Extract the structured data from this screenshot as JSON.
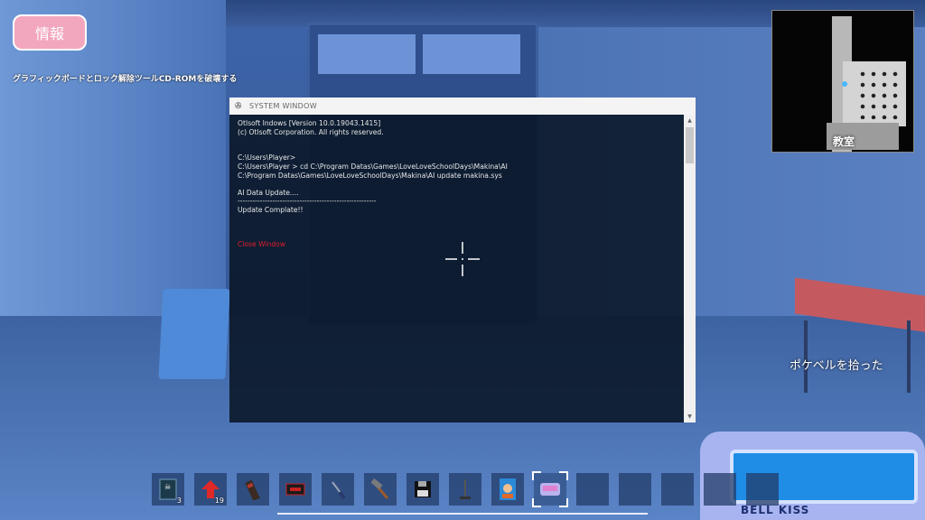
{
  "hud": {
    "info_button_label": "情報",
    "objective_text": "グラフィックボードとロック解除ツールCD-ROMを破壊する",
    "pickup_message": "ポケベルを拾った"
  },
  "minimap": {
    "location_label": "教室"
  },
  "system_window": {
    "title": "SYSTEM WINDOW",
    "lines": [
      "Otlsoft Indows [Version 10.0.19043.1415]",
      "(c) Otlsoft Corporation. All rights reserved.",
      "",
      "",
      "C:\\Users\\Player>",
      "C:\\Users\\Player > cd C:\\Program Datas\\Games\\LoveLoveSchoolDays\\Makina\\AI",
      "C:\\Program Datas\\Games\\LoveLoveSchoolDays\\Makina\\AI update makina.sys",
      "",
      "AI Data Update....",
      "--------------------------------------------------------",
      "Update Complate!!",
      "",
      "",
      ""
    ],
    "close_link": "Close Window"
  },
  "hotbar": {
    "slots": [
      {
        "icon": "cd-case-icon",
        "count": "3"
      },
      {
        "icon": "red-arrow-icon",
        "count": "19"
      },
      {
        "icon": "battery-pack-icon",
        "count": ""
      },
      {
        "icon": "red-device-icon",
        "count": ""
      },
      {
        "icon": "screwdriver-icon",
        "count": ""
      },
      {
        "icon": "hammer-icon",
        "count": ""
      },
      {
        "icon": "floppy-disk-icon",
        "count": ""
      },
      {
        "icon": "stand-icon",
        "count": ""
      },
      {
        "icon": "game-box-icon",
        "count": ""
      },
      {
        "icon": "pager-icon",
        "count": "",
        "selected": true
      },
      {
        "icon": "",
        "count": ""
      },
      {
        "icon": "",
        "count": ""
      },
      {
        "icon": "",
        "count": ""
      },
      {
        "icon": "",
        "count": ""
      },
      {
        "icon": "",
        "count": ""
      }
    ]
  },
  "device": {
    "label": "BELL KISS"
  }
}
